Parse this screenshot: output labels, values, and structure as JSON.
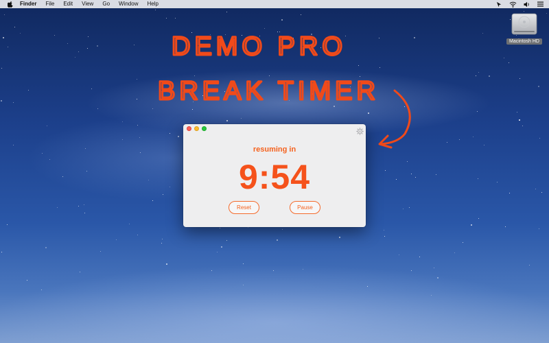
{
  "menubar": {
    "app_name": "Finder",
    "items": [
      "File",
      "Edit",
      "View",
      "Go",
      "Window",
      "Help"
    ],
    "icons": [
      "apple-icon",
      "cursor-icon",
      "wifi-icon",
      "volume-icon",
      "list-icon"
    ]
  },
  "desktop": {
    "disk_label": "Macintosh HD",
    "handwritten_title": [
      "DEMO PRO",
      "BREAK TIMER"
    ]
  },
  "timer": {
    "status": "resuming in",
    "time": "9:54",
    "reset_label": "Reset",
    "pause_label": "Pause",
    "accent_color": "#f5521b"
  }
}
